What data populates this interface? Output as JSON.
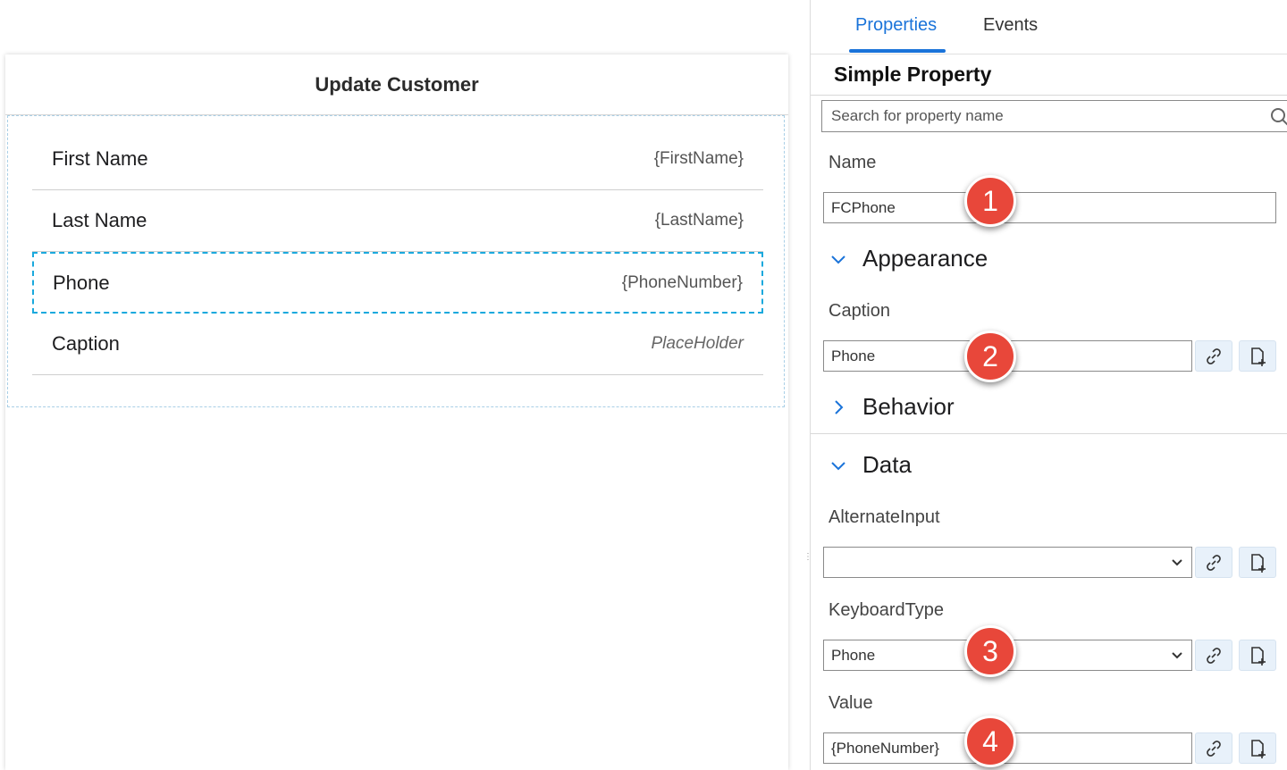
{
  "canvas": {
    "page_title": "Update Customer",
    "cells": [
      {
        "label": "First Name",
        "value": "{FirstName}"
      },
      {
        "label": "Last Name",
        "value": "{LastName}"
      },
      {
        "label": "Phone",
        "value": "{PhoneNumber}",
        "selected": true
      },
      {
        "label": "Caption",
        "value": "PlaceHolder",
        "placeholder": true
      }
    ]
  },
  "panel": {
    "tabs": [
      {
        "label": "Properties",
        "active": true
      },
      {
        "label": "Events",
        "active": false
      }
    ],
    "section_title": "Simple Property",
    "search": {
      "placeholder": "Search for property name",
      "value": ""
    },
    "name": {
      "label": "Name",
      "value": "FCPhone"
    },
    "groups": {
      "appearance": {
        "label": "Appearance",
        "expanded": true
      },
      "behavior": {
        "label": "Behavior",
        "expanded": false
      },
      "data": {
        "label": "Data",
        "expanded": true
      }
    },
    "caption": {
      "label": "Caption",
      "value": "Phone"
    },
    "alternate_input": {
      "label": "AlternateInput",
      "value": ""
    },
    "keyboard_type": {
      "label": "KeyboardType",
      "value": "Phone"
    },
    "value": {
      "label": "Value",
      "value": "{PhoneNumber}"
    }
  },
  "badges": [
    "1",
    "2",
    "3",
    "4"
  ],
  "colors": {
    "accent": "#1a73d9",
    "selection": "#1aa9dd",
    "badge": "#e8473a"
  },
  "icons": [
    "search-icon",
    "link-icon",
    "new-rule-icon",
    "chevron-down-icon",
    "chevron-right-icon"
  ]
}
